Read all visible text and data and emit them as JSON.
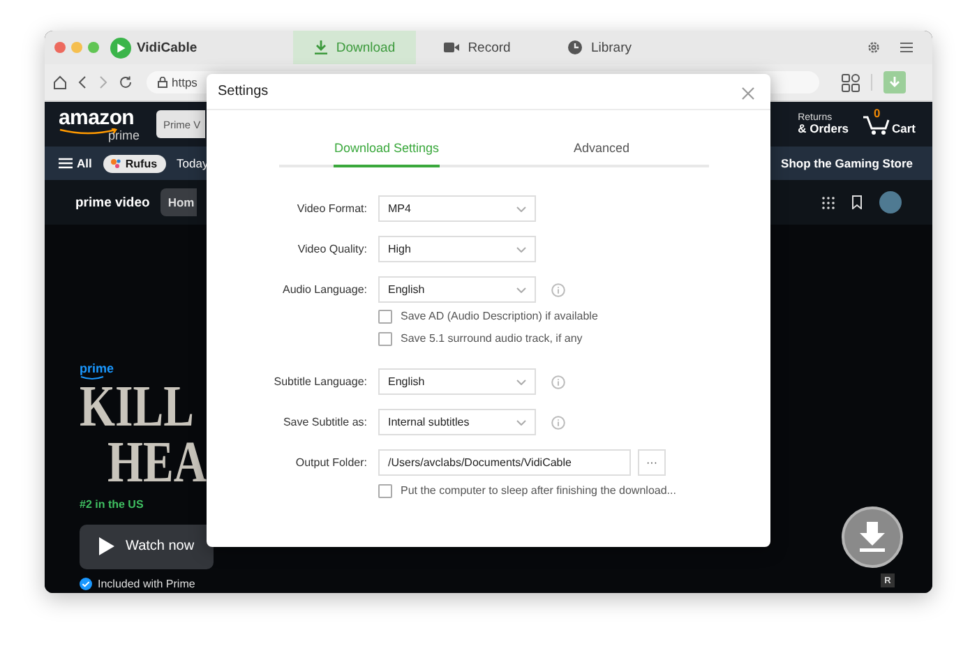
{
  "app": {
    "name": "VidiCable",
    "tabs": [
      {
        "label": "Download",
        "selected": true
      },
      {
        "label": "Record",
        "selected": false
      },
      {
        "label": "Library",
        "selected": false
      }
    ]
  },
  "browser": {
    "url": "https"
  },
  "amazon": {
    "logo": "amazon",
    "logo_sub": "prime",
    "search": "Prime V",
    "returns_line1": "Returns",
    "returns_line2": "& Orders",
    "cart_count": "0",
    "cart_label": "Cart"
  },
  "nav": {
    "menu": "All",
    "assistant": "Rufus",
    "link": "Today",
    "promo": "Shop the Gaming Store"
  },
  "prime_video": {
    "logo": "prime video",
    "home": "Hom"
  },
  "hero": {
    "badge": "prime",
    "title_lines": [
      "KILL",
      "HEA"
    ],
    "rank": "#2 in the US",
    "watch": "Watch now",
    "included": "Included with Prime"
  },
  "rating_badge": "R",
  "settings": {
    "title": "Settings",
    "tabs": [
      {
        "label": "Download Settings",
        "selected": true
      },
      {
        "label": "Advanced",
        "selected": false
      }
    ],
    "rows": [
      {
        "kind": "select",
        "label": "Video Format:",
        "value": "MP4",
        "info": false
      },
      {
        "kind": "select",
        "label": "Video Quality:",
        "value": "High",
        "info": false
      },
      {
        "kind": "select",
        "label": "Audio Language:",
        "value": "English",
        "info": true
      },
      {
        "kind": "checkbox",
        "label": "Save AD (Audio Description) if available",
        "checked": false
      },
      {
        "kind": "checkbox",
        "label": "Save 5.1 surround audio track, if any",
        "checked": false
      },
      {
        "kind": "select",
        "label": "Subtitle Language:",
        "value": "English",
        "info": true
      },
      {
        "kind": "select",
        "label": "Save Subtitle as:",
        "value": "Internal subtitles",
        "info": true
      },
      {
        "kind": "folder",
        "label": "Output Folder:",
        "value": "/Users/avclabs/Documents/VidiCable",
        "button": "···"
      },
      {
        "kind": "checkbox",
        "label": "Put the computer to sleep after finishing the download...",
        "checked": false
      }
    ]
  }
}
